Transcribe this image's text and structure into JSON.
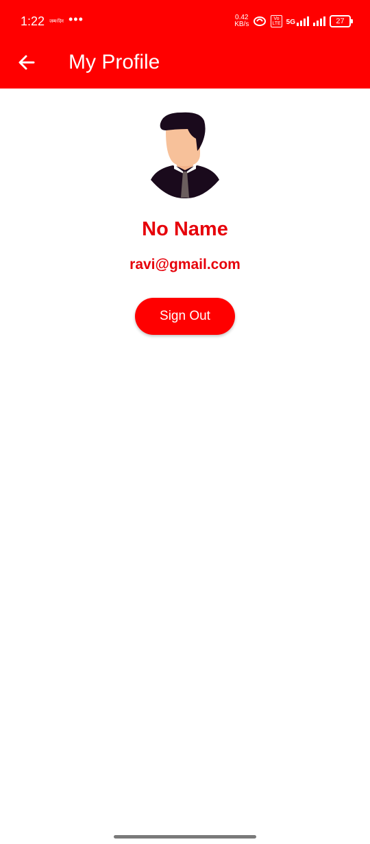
{
  "status_bar": {
    "time": "1:22",
    "notification_text": "जन्म-दिन",
    "dots": "•••",
    "net_speed_value": "0.42",
    "net_speed_unit": "KB/s",
    "volte_label_top": "Vo",
    "volte_label_bottom": "LTE",
    "network_type": "5G",
    "battery_level": "27"
  },
  "app_bar": {
    "title": "My Profile",
    "back_icon": "arrow-left-icon"
  },
  "profile": {
    "avatar_icon": "user-avatar-icon",
    "name": "No Name",
    "email": "ravi@gmail.com",
    "sign_out_label": "Sign Out"
  },
  "colors": {
    "primary": "#ff0000",
    "text_accent": "#e6000a",
    "background": "#ffffff"
  }
}
